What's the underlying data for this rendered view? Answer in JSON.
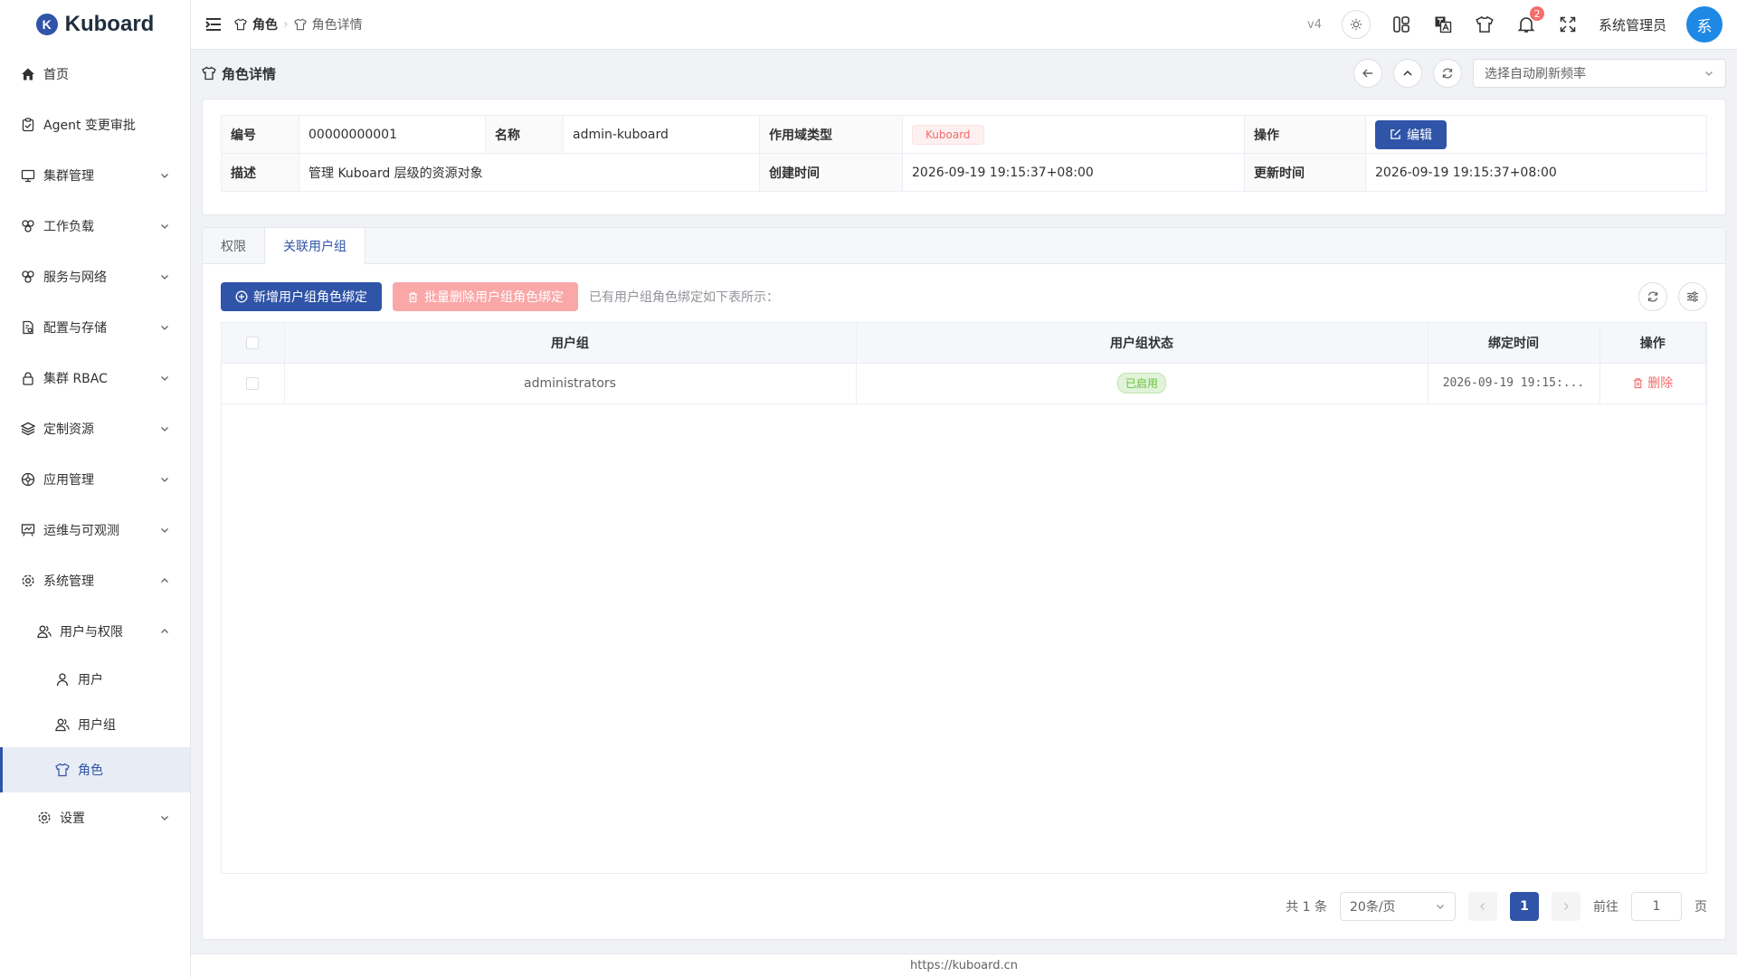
{
  "app": {
    "name": "Kuboard",
    "logo_letter": "K"
  },
  "sidebar": {
    "items": [
      {
        "label": "首页",
        "icon": "home-icon"
      },
      {
        "label": "Agent 变更审批",
        "icon": "clipboard-check-icon"
      },
      {
        "label": "集群管理",
        "icon": "monitor-icon"
      },
      {
        "label": "工作负载",
        "icon": "cubes-icon"
      },
      {
        "label": "服务与网络",
        "icon": "network-icon"
      },
      {
        "label": "配置与存储",
        "icon": "config-file-icon"
      },
      {
        "label": "集群 RBAC",
        "icon": "lock-icon"
      },
      {
        "label": "定制资源",
        "icon": "layers-icon"
      },
      {
        "label": "应用管理",
        "icon": "app-wheel-icon"
      },
      {
        "label": "运维与可观测",
        "icon": "dashboard-icon"
      },
      {
        "label": "系统管理",
        "icon": "gear-icon"
      }
    ],
    "sub_users_permissions": "用户与权限",
    "sub_user": "用户",
    "sub_usergroup": "用户组",
    "sub_role": "角色",
    "sub_settings": "设置"
  },
  "topbar": {
    "breadcrumb_root": "角色",
    "breadcrumb_current": "角色详情",
    "version": "v4",
    "notification_count": "2",
    "username": "系统管理员",
    "avatar_text": "系"
  },
  "page": {
    "title": "角色详情",
    "auto_refresh_placeholder": "选择自动刷新频率"
  },
  "details": {
    "id_label": "编号",
    "id_value": "00000000001",
    "name_label": "名称",
    "name_value": "admin-kuboard",
    "scope_label": "作用域类型",
    "scope_value": "Kuboard",
    "ops_label": "操作",
    "edit_button": "编辑",
    "desc_label": "描述",
    "desc_value": "管理 Kuboard 层级的资源对象",
    "created_label": "创建时间",
    "created_value": "2026-09-19 19:15:37+08:00",
    "updated_label": "更新时间",
    "updated_value": "2026-09-19 19:15:37+08:00"
  },
  "tabs": {
    "permissions": "权限",
    "linked_groups": "关联用户组"
  },
  "toolbar": {
    "add_button": "新增用户组角色绑定",
    "batch_delete_button": "批量删除用户组角色绑定",
    "hint": "已有用户组角色绑定如下表所示："
  },
  "table": {
    "headers": {
      "group": "用户组",
      "status": "用户组状态",
      "bind_time": "绑定时间",
      "ops": "操作"
    },
    "rows": [
      {
        "group": "administrators",
        "status": "已启用",
        "bind_time": "2026-09-19 19:15:...",
        "op": "删除"
      }
    ]
  },
  "pagination": {
    "total": "共 1 条",
    "page_size": "20条/页",
    "current_page": "1",
    "goto_label": "前往",
    "goto_value": "1",
    "page_suffix": "页"
  },
  "footer": {
    "url": "https://kuboard.cn"
  },
  "colors": {
    "primary": "#2f54a8",
    "danger": "#f56c6c",
    "success": "#67c23a",
    "avatar": "#1e88e5"
  }
}
